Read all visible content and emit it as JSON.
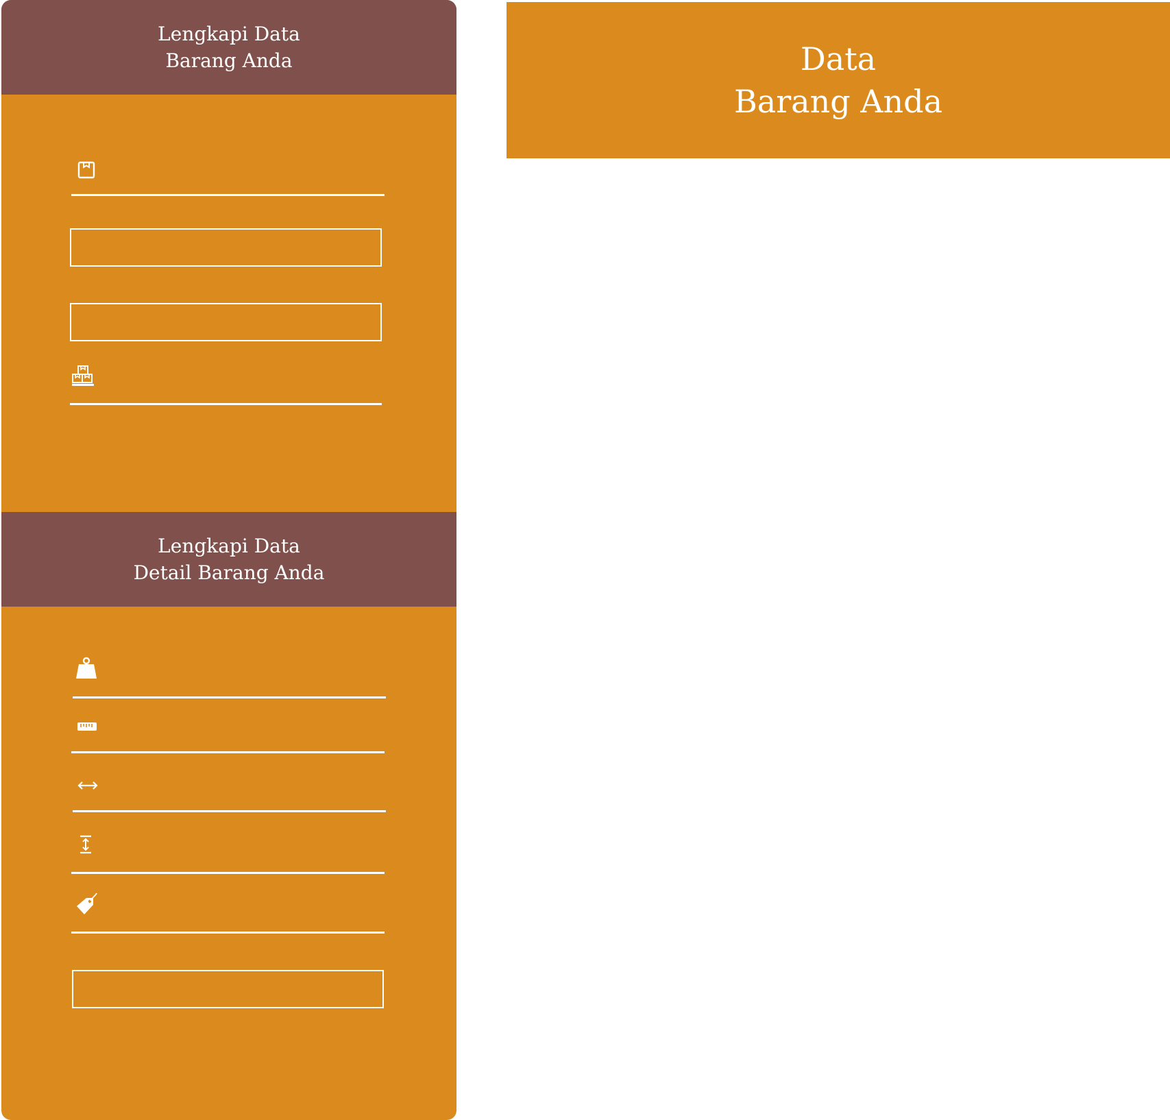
{
  "form": {
    "section_1": {
      "title_line_1": "Lengkapi Data",
      "title_line_2": "Barang Anda",
      "fields": [
        {
          "icon": "package-icon",
          "value": "",
          "placeholder": ""
        },
        {
          "icon": "",
          "value": "",
          "placeholder": ""
        },
        {
          "icon": "",
          "value": "",
          "placeholder": ""
        },
        {
          "icon": "boxes-icon",
          "value": "",
          "placeholder": ""
        }
      ]
    },
    "section_2": {
      "title_line_1": "Lengkapi Data",
      "title_line_2": "Detail Barang Anda",
      "fields": [
        {
          "icon": "weight-icon",
          "value": "",
          "placeholder": ""
        },
        {
          "icon": "ruler-icon",
          "value": "",
          "placeholder": ""
        },
        {
          "icon": "width-arrows-icon",
          "value": "",
          "placeholder": ""
        },
        {
          "icon": "height-arrows-icon",
          "value": "",
          "placeholder": ""
        },
        {
          "icon": "price-tag-icon",
          "value": "",
          "placeholder": ""
        },
        {
          "icon": "",
          "value": "",
          "placeholder": ""
        }
      ]
    }
  },
  "result": {
    "title_line_1": "Data",
    "title_line_2": "Barang Anda"
  },
  "colors": {
    "panel": "#DB8A1D",
    "header": "#80514C",
    "text": "#FFFFFF",
    "background": "#FFFFFF"
  }
}
